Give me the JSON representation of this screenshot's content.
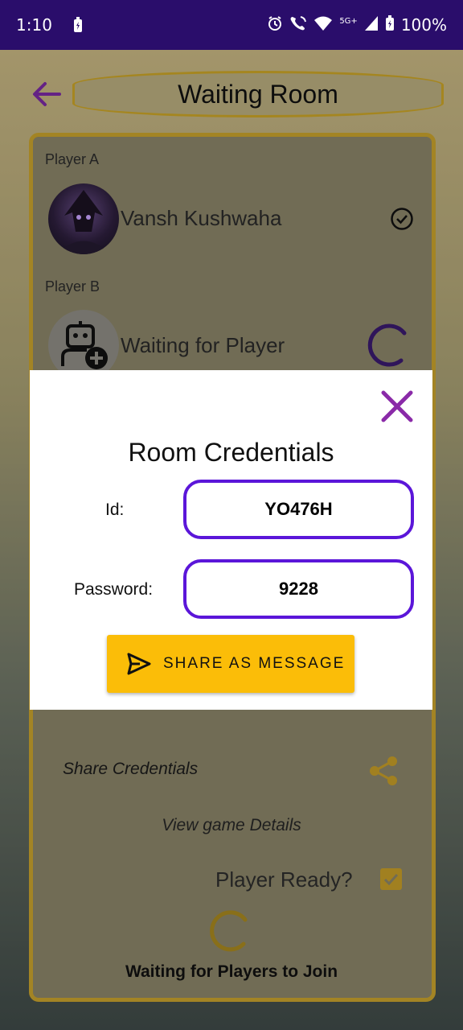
{
  "status_bar": {
    "time": "1:10",
    "network": "5G+",
    "battery": "100%"
  },
  "header": {
    "title": "Waiting Room"
  },
  "players": {
    "a": {
      "label": "Player A",
      "name": "Vansh Kushwaha"
    },
    "b": {
      "label": "Player B",
      "name": "Waiting for Player"
    }
  },
  "actions": {
    "share_credentials": "Share Credentials",
    "view_details": "View game Details",
    "player_ready": "Player Ready?",
    "player_ready_checked": true,
    "waiting_text": "Waiting for Players to Join"
  },
  "dialog": {
    "title": "Room Credentials",
    "id_label": "Id:",
    "id_value": "YO476H",
    "password_label": "Password:",
    "password_value": "9228",
    "share_button": "SHARE AS MESSAGE"
  },
  "colors": {
    "status_bar": "#2a0d6b",
    "accent_purple": "#5b16d9",
    "accent_gold": "#c7a12c",
    "share_button": "#fbbd08"
  },
  "icons": [
    "back-arrow-icon",
    "check-circle-icon",
    "add-user-icon",
    "loading-spinner-icon",
    "share-icon",
    "close-icon",
    "send-icon"
  ]
}
